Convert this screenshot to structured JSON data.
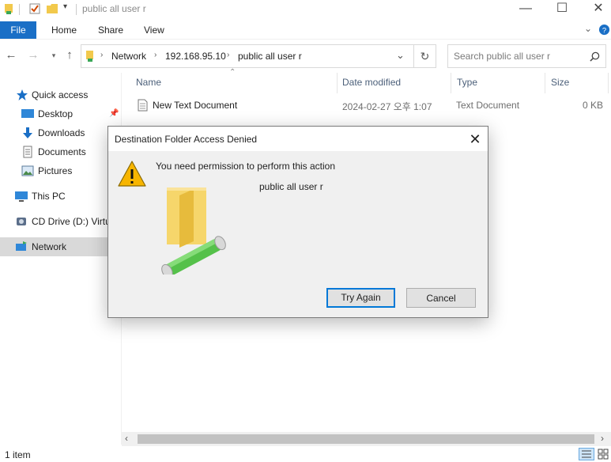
{
  "window": {
    "title": "public all user r",
    "controls": {
      "minimize": "—",
      "maximize": "☐",
      "close": "✕"
    }
  },
  "ribbon": {
    "file_tab": "File",
    "tabs": [
      "Home",
      "Share",
      "View"
    ],
    "expand_icon": "chevron-down-icon",
    "help_icon": "help-icon"
  },
  "address": {
    "crumbs": [
      "Network",
      "192.168.95.10",
      "public all user r"
    ],
    "search_placeholder": "Search public all user r"
  },
  "sidebar": {
    "quick_access": "Quick access",
    "items": [
      {
        "label": "Desktop",
        "icon": "desktop-icon",
        "pinned": true
      },
      {
        "label": "Downloads",
        "icon": "downloads-icon"
      },
      {
        "label": "Documents",
        "icon": "documents-icon"
      },
      {
        "label": "Pictures",
        "icon": "pictures-icon"
      }
    ],
    "this_pc": "This PC",
    "cd_drive": "CD Drive (D:) VirtualBox Guest Additions",
    "network": "Network"
  },
  "columns": {
    "name": "Name",
    "date": "Date modified",
    "type": "Type",
    "size": "Size"
  },
  "files": [
    {
      "name": "New Text Document",
      "date": "2024-02-27 오후 1:07",
      "type": "Text Document",
      "size": "0 KB"
    }
  ],
  "status": {
    "count": "1 item"
  },
  "dialog": {
    "title": "Destination Folder Access Denied",
    "message": "You need permission to perform this action",
    "target": "public all user r",
    "try_again": "Try Again",
    "cancel": "Cancel"
  },
  "colors": {
    "accent": "#1a6fc6",
    "selection": "#d9d9d9",
    "dialog_bg": "#f0f0f0",
    "focus": "#0078d7"
  }
}
